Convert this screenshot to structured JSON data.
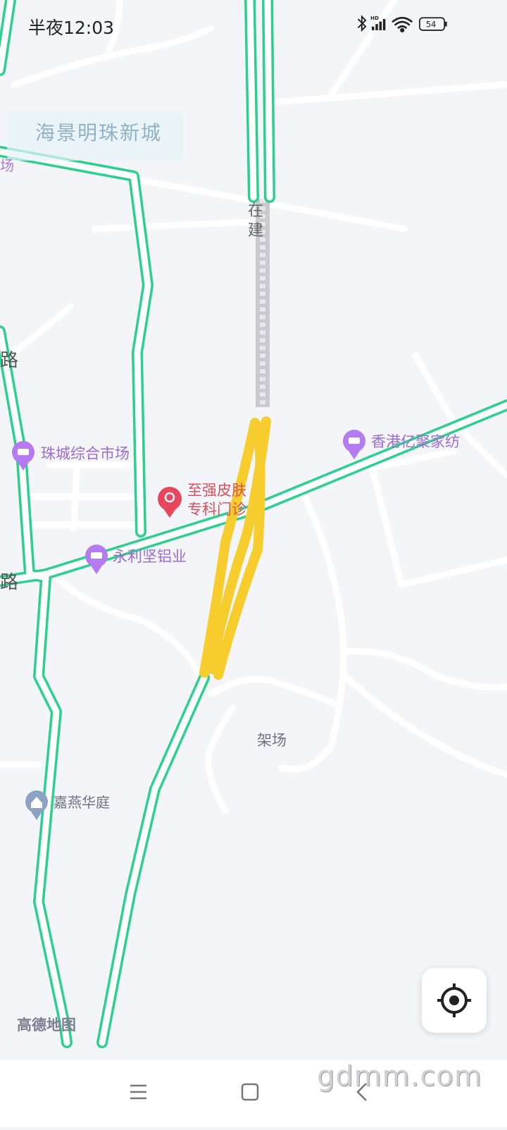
{
  "status_bar": {
    "time": "半夜12:03",
    "battery": "54",
    "network_badge": "HD",
    "icons": [
      "bluetooth-icon",
      "signal-icon",
      "wifi-icon",
      "battery-icon"
    ]
  },
  "map": {
    "area_labels": {
      "haijing": "海景明珠新城",
      "chang_left": "场",
      "road_vertical_left": "路",
      "road_left_bottom": "路",
      "jiachang": "架场",
      "zaijian_1": "在",
      "zaijian_2": "建"
    },
    "pois": {
      "zhucheng": "珠城综合市场",
      "xianggang": "香港亿聚家纺",
      "zhiqiang_line1": "至强皮肤",
      "zhiqiang_line2": "专科门诊",
      "yongli": "永利坚铝业",
      "jiayan": "嘉燕华庭"
    },
    "brand": "高德地图",
    "colors": {
      "background": "#f4f5f8",
      "road_outline": "#2bd08e",
      "road_fill": "#ffffff",
      "track": "#f7cd2d",
      "poi_purple": "#b57bf0",
      "poi_red": "#e8465c",
      "construction": "#c9c9cf"
    }
  },
  "controls": {
    "locate_icon": "locate-icon"
  },
  "navigation": {
    "menu_icon": "menu-icon",
    "home_icon": "home-square-icon",
    "back_icon": "back-chevron-icon"
  },
  "watermark": "gdmm.com"
}
